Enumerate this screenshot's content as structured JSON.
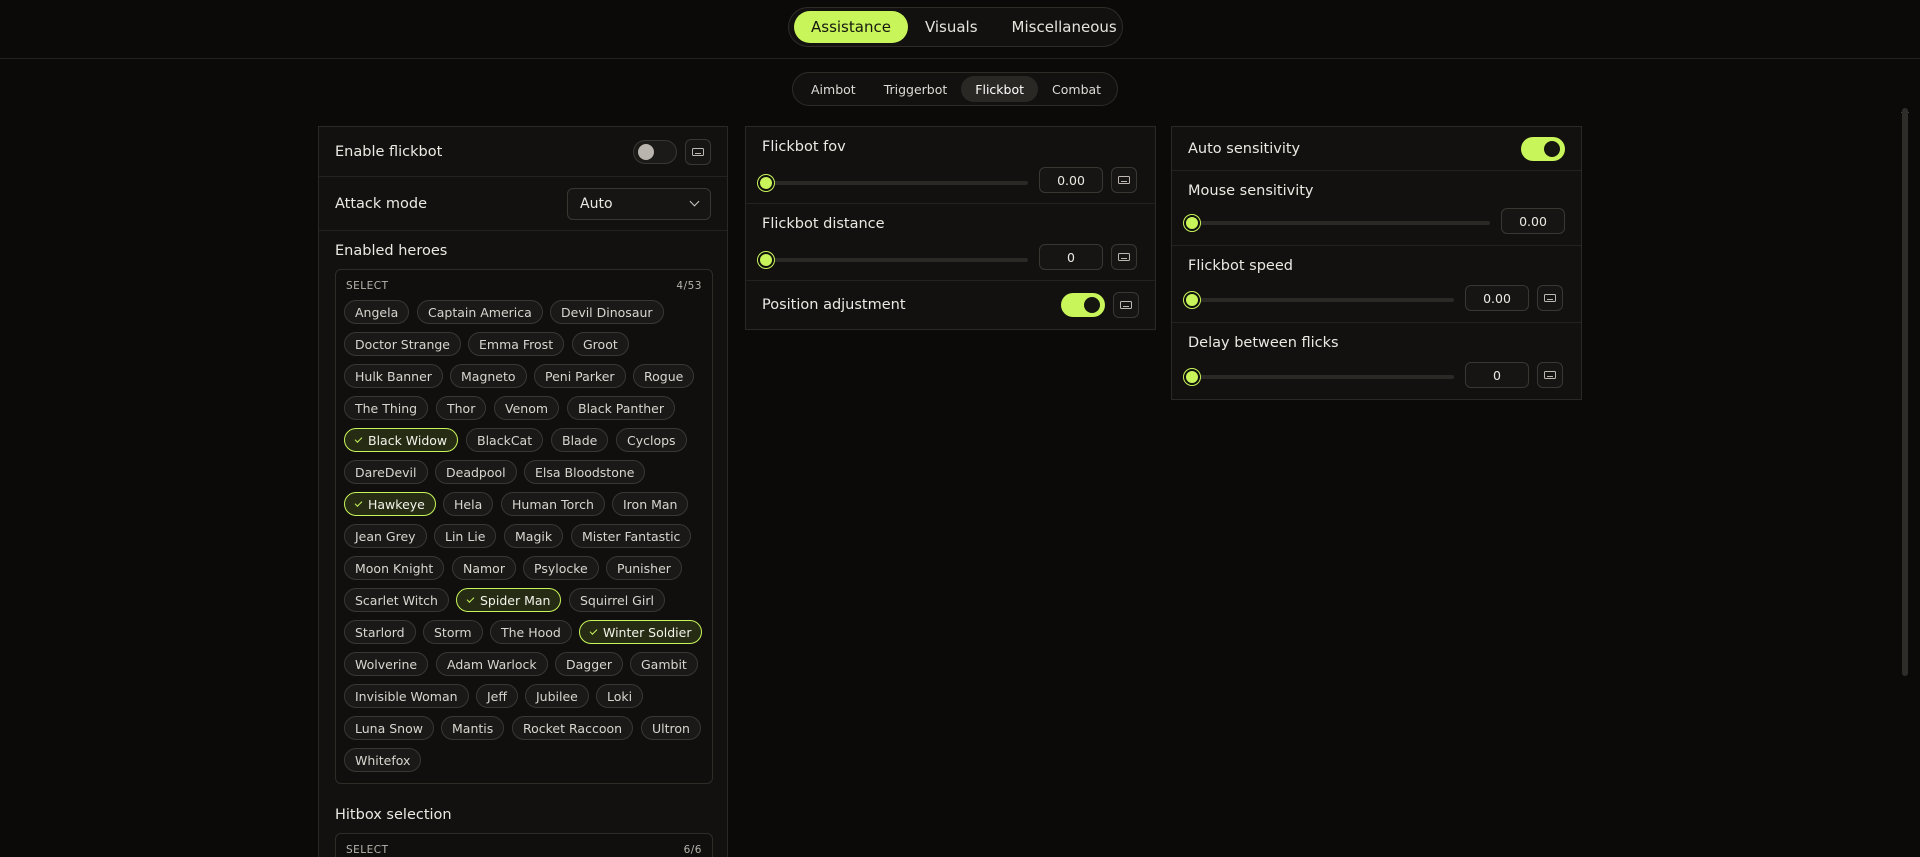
{
  "top_tabs": [
    {
      "label": "Assistance",
      "active": true
    },
    {
      "label": "Visuals",
      "active": false
    },
    {
      "label": "Miscellaneous",
      "active": false
    }
  ],
  "sub_tabs": [
    {
      "label": "Aimbot",
      "active": false
    },
    {
      "label": "Triggerbot",
      "active": false
    },
    {
      "label": "Flickbot",
      "active": true
    },
    {
      "label": "Combat",
      "active": false
    }
  ],
  "left_panel": {
    "enable_flickbot": {
      "label": "Enable flickbot",
      "enabled": false
    },
    "attack_mode": {
      "label": "Attack mode",
      "value": "Auto"
    },
    "enabled_heroes": {
      "title": "Enabled heroes",
      "select_label": "SELECT",
      "count": "4/53",
      "heroes": [
        {
          "name": "Angela",
          "selected": false
        },
        {
          "name": "Captain America",
          "selected": false
        },
        {
          "name": "Devil Dinosaur",
          "selected": false
        },
        {
          "name": "Doctor Strange",
          "selected": false
        },
        {
          "name": "Emma Frost",
          "selected": false
        },
        {
          "name": "Groot",
          "selected": false
        },
        {
          "name": "Hulk Banner",
          "selected": false
        },
        {
          "name": "Magneto",
          "selected": false
        },
        {
          "name": "Peni Parker",
          "selected": false
        },
        {
          "name": "Rogue",
          "selected": false
        },
        {
          "name": "The Thing",
          "selected": false
        },
        {
          "name": "Thor",
          "selected": false
        },
        {
          "name": "Venom",
          "selected": false
        },
        {
          "name": "Black Panther",
          "selected": false
        },
        {
          "name": "Black Widow",
          "selected": true
        },
        {
          "name": "BlackCat",
          "selected": false
        },
        {
          "name": "Blade",
          "selected": false
        },
        {
          "name": "Cyclops",
          "selected": false
        },
        {
          "name": "DareDevil",
          "selected": false
        },
        {
          "name": "Deadpool",
          "selected": false
        },
        {
          "name": "Elsa Bloodstone",
          "selected": false
        },
        {
          "name": "Hawkeye",
          "selected": true
        },
        {
          "name": "Hela",
          "selected": false
        },
        {
          "name": "Human Torch",
          "selected": false
        },
        {
          "name": "Iron Man",
          "selected": false
        },
        {
          "name": "Jean Grey",
          "selected": false
        },
        {
          "name": "Lin Lie",
          "selected": false
        },
        {
          "name": "Magik",
          "selected": false
        },
        {
          "name": "Mister Fantastic",
          "selected": false
        },
        {
          "name": "Moon Knight",
          "selected": false
        },
        {
          "name": "Namor",
          "selected": false
        },
        {
          "name": "Psylocke",
          "selected": false
        },
        {
          "name": "Punisher",
          "selected": false
        },
        {
          "name": "Scarlet Witch",
          "selected": false
        },
        {
          "name": "Spider Man",
          "selected": true
        },
        {
          "name": "Squirrel Girl",
          "selected": false
        },
        {
          "name": "Starlord",
          "selected": false
        },
        {
          "name": "Storm",
          "selected": false
        },
        {
          "name": "The Hood",
          "selected": false
        },
        {
          "name": "Winter Soldier",
          "selected": true
        },
        {
          "name": "Wolverine",
          "selected": false
        },
        {
          "name": "Adam Warlock",
          "selected": false
        },
        {
          "name": "Dagger",
          "selected": false
        },
        {
          "name": "Gambit",
          "selected": false
        },
        {
          "name": "Invisible Woman",
          "selected": false
        },
        {
          "name": "Jeff",
          "selected": false
        },
        {
          "name": "Jubilee",
          "selected": false
        },
        {
          "name": "Loki",
          "selected": false
        },
        {
          "name": "Luna Snow",
          "selected": false
        },
        {
          "name": "Mantis",
          "selected": false
        },
        {
          "name": "Rocket Raccoon",
          "selected": false
        },
        {
          "name": "Ultron",
          "selected": false
        },
        {
          "name": "Whitefox",
          "selected": false
        }
      ]
    },
    "hitbox_selection": {
      "title": "Hitbox selection",
      "select_label": "SELECT",
      "count": "6/6"
    }
  },
  "middle_panel": {
    "flickbot_fov": {
      "label": "Flickbot fov",
      "value": "0.00",
      "fraction": 0
    },
    "flickbot_distance": {
      "label": "Flickbot distance",
      "value": "0",
      "fraction": 0
    },
    "position_adjustment": {
      "label": "Position adjustment",
      "enabled": true
    }
  },
  "right_panel": {
    "auto_sensitivity": {
      "label": "Auto sensitivity",
      "enabled": true
    },
    "mouse_sensitivity": {
      "label": "Mouse sensitivity",
      "value": "0.00",
      "fraction": 0
    },
    "flickbot_speed": {
      "label": "Flickbot speed",
      "value": "0.00",
      "fraction": 0
    },
    "delay_between_flicks": {
      "label": "Delay between flicks",
      "value": "0",
      "fraction": 0
    }
  },
  "colors": {
    "accent": "#c8f55a",
    "background": "#0b0a09",
    "panel": "#121110"
  }
}
